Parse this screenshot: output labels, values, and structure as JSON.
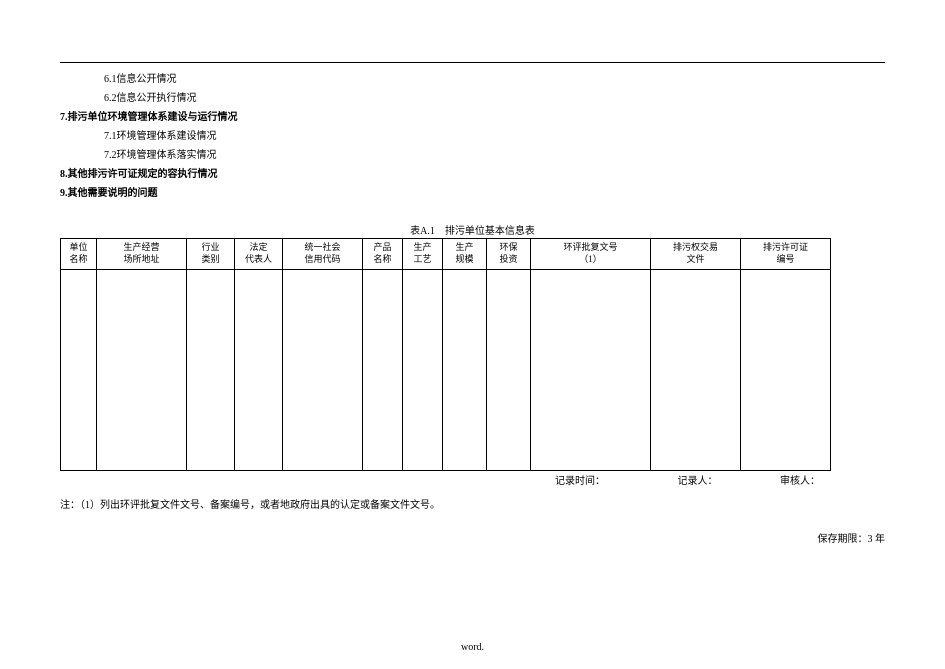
{
  "outline": {
    "i61": "6.1信息公开情况",
    "i62": "6.2信息公开执行情况",
    "i7": "7.排污单位环境管理体系建设与运行情况",
    "i71": "7.1环境管理体系建设情况",
    "i72": "7.2环境管理体系落实情况",
    "i8": "8.其他排污许可证规定的容执行情况",
    "i9": "9.其他需要说明的问题"
  },
  "table": {
    "title": "表A.1　排污单位基本信息表",
    "headers": {
      "c1": "单位\n名称",
      "c2": "生产经营\n场所地址",
      "c3": "行业\n类别",
      "c4": "法定\n代表人",
      "c5": "统一社会\n信用代码",
      "c6": "产品\n名称",
      "c7": "生产\n工艺",
      "c8": "生产\n规模",
      "c9": "环保\n投资",
      "c10": "环评批复文号\n（1）",
      "c11": "排污权交易\n文件",
      "c12": "排污许可证\n编号"
    }
  },
  "sign": {
    "time": "记录时间：",
    "record": "记录人：",
    "review": "审核人："
  },
  "note": "注：（1）列出环评批复文件文号、备案编号，或者地政府出具的认定或备案文件文号。",
  "retain": "保存期限：3 年",
  "footer": "word.",
  "chart_data": {
    "type": "table",
    "title": "表A.1 排污单位基本信息表",
    "columns": [
      "单位名称",
      "生产经营场所地址",
      "行业类别",
      "法定代表人",
      "统一社会信用代码",
      "产品名称",
      "生产工艺",
      "生产规模",
      "环保投资",
      "环评批复文号（1）",
      "排污权交易文件",
      "排污许可证编号"
    ],
    "rows": []
  }
}
